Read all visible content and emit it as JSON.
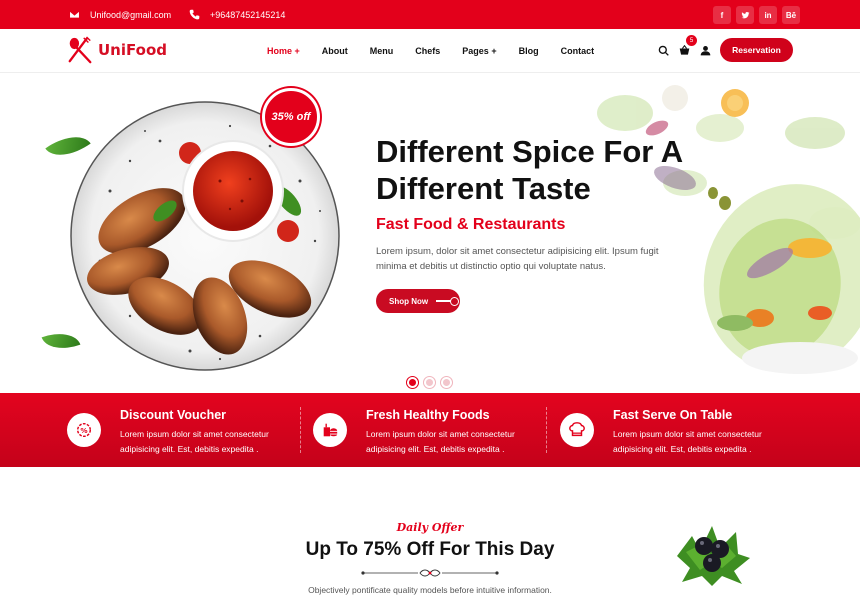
{
  "topbar": {
    "email": "Unifood@gmail.com",
    "phone": "+96487452145214",
    "socials": [
      "f",
      "t",
      "in",
      "Bē"
    ]
  },
  "header": {
    "logo_text": "UniFood",
    "nav": [
      {
        "label": "Home"
      },
      {
        "label": "About"
      },
      {
        "label": "Menu"
      },
      {
        "label": "Chefs"
      },
      {
        "label": "Pages"
      },
      {
        "label": "Blog"
      },
      {
        "label": "Contact"
      }
    ],
    "cart_count": "5",
    "reservation_label": "Reservation"
  },
  "hero": {
    "badge": "35% off",
    "title": "Different Spice For A Different Taste",
    "subtitle": "Fast Food & Restaurants",
    "text": "Lorem ipsum, dolor sit amet consectetur adipisicing elit. Ipsum fugit minima et debitis ut distinctio optio qui voluptate natus.",
    "cta_label": "Shop Now",
    "active_slide": 1,
    "slide_count": 3
  },
  "features": [
    {
      "icon": "discount-icon",
      "title": "Discount Voucher",
      "text": "Lorem ipsum dolor sit amet consectetur adipisicing elit. Est, debitis expedita ."
    },
    {
      "icon": "fast-food-icon",
      "title": "Fresh Healthy Foods",
      "text": "Lorem ipsum dolor sit amet consectetur adipisicing elit. Est, debitis expedita ."
    },
    {
      "icon": "chef-hat-icon",
      "title": "Fast Serve On Table",
      "text": "Lorem ipsum dolor sit amet consectetur adipisicing elit. Est, debitis expedita ."
    }
  ],
  "offer": {
    "tag": "Daily Offer",
    "title": "Up To 75% Off For This Day",
    "text": "Objectively pontificate quality models before intuitive information."
  },
  "colors": {
    "primary": "#e3001b",
    "dark": "#111111"
  }
}
